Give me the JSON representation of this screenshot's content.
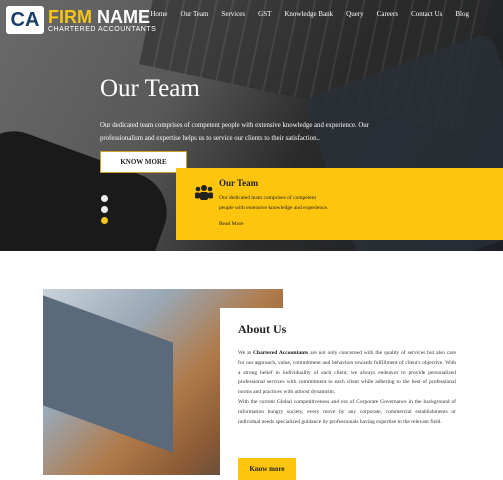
{
  "logo": {
    "mark": "CA",
    "name_1": "FIRM",
    "name_2": "NAME",
    "sub": "CHARTERED ACCOUNTANTS"
  },
  "nav": [
    "Home",
    "Our Team",
    "Services",
    "GST",
    "Knowledge Bank",
    "Query",
    "Careers",
    "Contact Us",
    "Blog"
  ],
  "hero": {
    "title": "Our Team",
    "desc": "Our dedicated team comprises of competent people with extensive knowledge and experience. Our professionalism and expertise helps us to service our clients to their satisfaction..",
    "button": "KNOW MORE",
    "slides": 3,
    "active_slide": 3
  },
  "feature": {
    "icon": "users-icon",
    "title": "Our Team",
    "text": "Our dedicated team comprises of competent people with extensive knowledge and experience.",
    "link": "Read More"
  },
  "about": {
    "title": "About Us",
    "p1_a": "We at ",
    "p1_bold": "Chartered Accountants",
    "p1_b": " are not only concerned with the quality of services but also care for our approach, value, commitment and behaviors towards fulfillment of client's objective. With a strong belief in individuality of each client, we always endeavor to provide personalized professional services with commitment to each client while adhering to the best of professional norms and practices with utmost dynamism.",
    "p2": "With the current Global competitiveness and era of Corporate Governance in the background of information hungry society, every move by any corporate, commercial establishments or individual needs specialized guidance by professionals having expertise in the relevant field.",
    "button": "Know more"
  }
}
